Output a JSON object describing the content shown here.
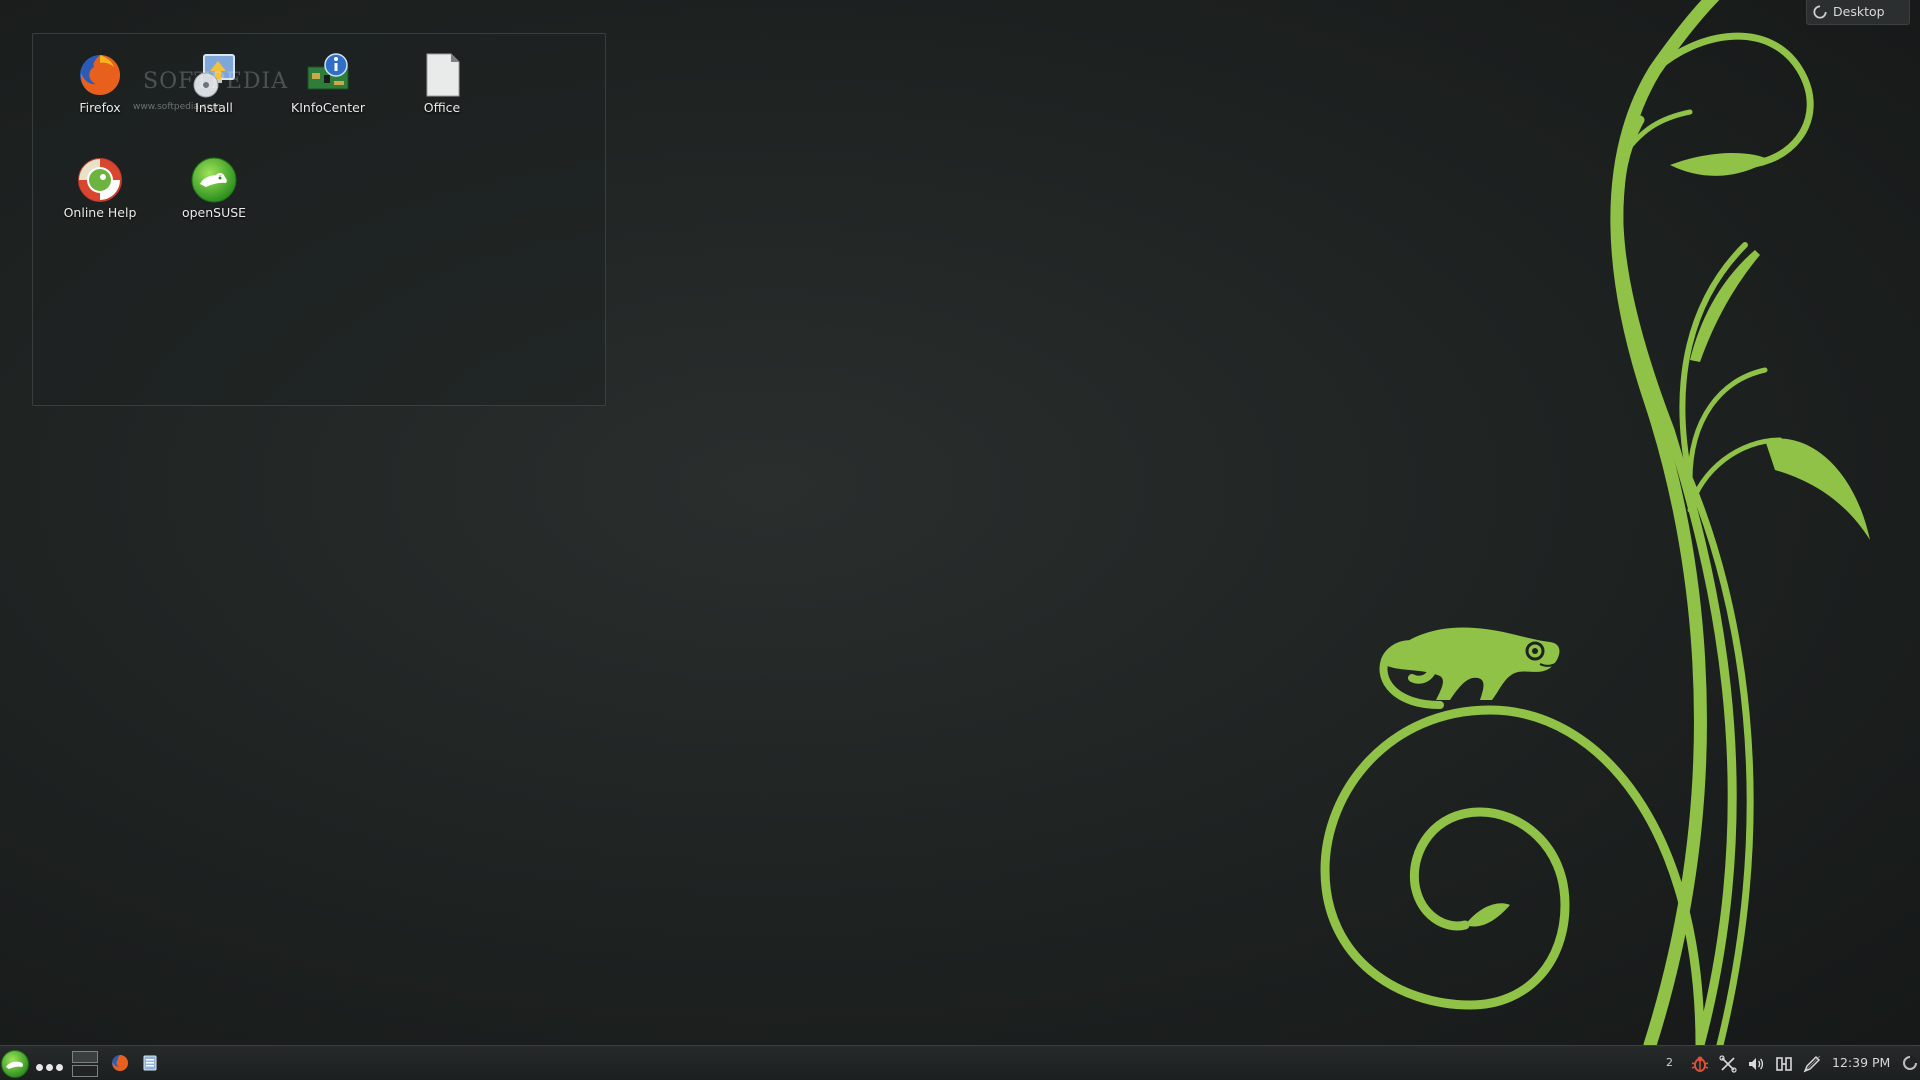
{
  "desktop": {
    "wallpaper": "openSUSE chameleon vine",
    "accent_color": "#8fc246",
    "background_color": "#1d2120"
  },
  "folder_view": {
    "icons": [
      {
        "label": "Firefox",
        "icon": "firefox-icon"
      },
      {
        "label": "Install",
        "icon": "install-icon"
      },
      {
        "label": "KInfoCenter",
        "icon": "kinfocenter-icon"
      },
      {
        "label": "Office",
        "icon": "office-document-icon"
      },
      {
        "label": "Online Help",
        "icon": "online-help-icon"
      },
      {
        "label": "openSUSE",
        "icon": "opensuse-icon"
      }
    ],
    "watermark": "SOFTPEDIA",
    "watermark_sub": "www.softpedia.com"
  },
  "toolbox": {
    "label": "Desktop"
  },
  "panel": {
    "launcher_icon": "opensuse-launcher-icon",
    "tasks": [
      {
        "icon": "firefox-icon"
      },
      {
        "icon": "dolphin-file-manager-icon"
      }
    ],
    "tray": {
      "notification_count": "2",
      "icons": [
        "bug-icon",
        "network-disconnected-icon",
        "volume-icon",
        "clipboard-icon",
        "pen-icon"
      ]
    },
    "clock": "12:39 PM"
  }
}
